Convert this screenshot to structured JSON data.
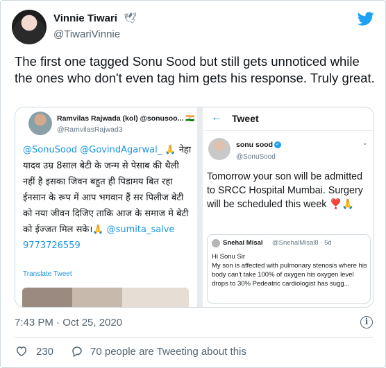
{
  "author": {
    "display_name": "Vinnie Tiwari",
    "name_emoji": "🕊",
    "handle": "@TiwariVinnie"
  },
  "tweet": {
    "text": "The first one tagged Sonu Sood but still gets unnoticed while the ones who don't even tag him gets his response. Truly great.",
    "timestamp": "7:43 PM · Oct 25, 2020",
    "likes": "230",
    "people_tweeting": "70 people are Tweeting about this"
  },
  "media": {
    "left": {
      "name": "Ramvilas Rajwada (kol) @sonusoo...",
      "name_flag": "🇮🇳",
      "handle": "@RamvilasRajwad3",
      "mention1": "@SonuSood",
      "mention2": "@GovindAgarwal_",
      "body_emoji": "🙏",
      "body": "नेहा यादव उम्र 8साल बेटी के जन्म से पेसाब की थैली नहीं है इसका जिवन बहुत ही पिडामय बित रहा ईनसान के रूप में आप भगवान हैं सर पिलीज बेटी को नया जीवन दिजिए ताकि आज के समाज मे बेटी को ईज्जत मिल सके।",
      "body_emoji2": "🙏",
      "mention3": "@sumita_salve",
      "phone": "9773726559",
      "translate_label": "Translate Tweet"
    },
    "right": {
      "back_arrow": "←",
      "header_title": "Tweet",
      "name": "sonu sood",
      "handle": "@SonuSood",
      "caret": "⌄",
      "body": "Tomorrow your son will be admitted to SRCC Hospital Mumbai. Surgery will be scheduled this week",
      "body_emoji": "❣️🙏",
      "quote": {
        "name": "Snehal Misal",
        "handle_time": "@SnehalMisal8 · 5d",
        "body": "Hi Sonu Sir\nMy son is affected with pulmonary stenosis where his body can't take 100% of oxygen his oxygen level\ndrops to 30% Pedeatric cardiologist has sugg..."
      }
    }
  },
  "icons": {
    "platform": "bird-icon",
    "info": "info-icon",
    "like": "heart-icon",
    "comment": "speech-bubble-icon"
  },
  "colors": {
    "accent": "#1da1f2",
    "link": "#1b95e0",
    "muted": "#536471",
    "heart_emoji": "#e0245e"
  }
}
